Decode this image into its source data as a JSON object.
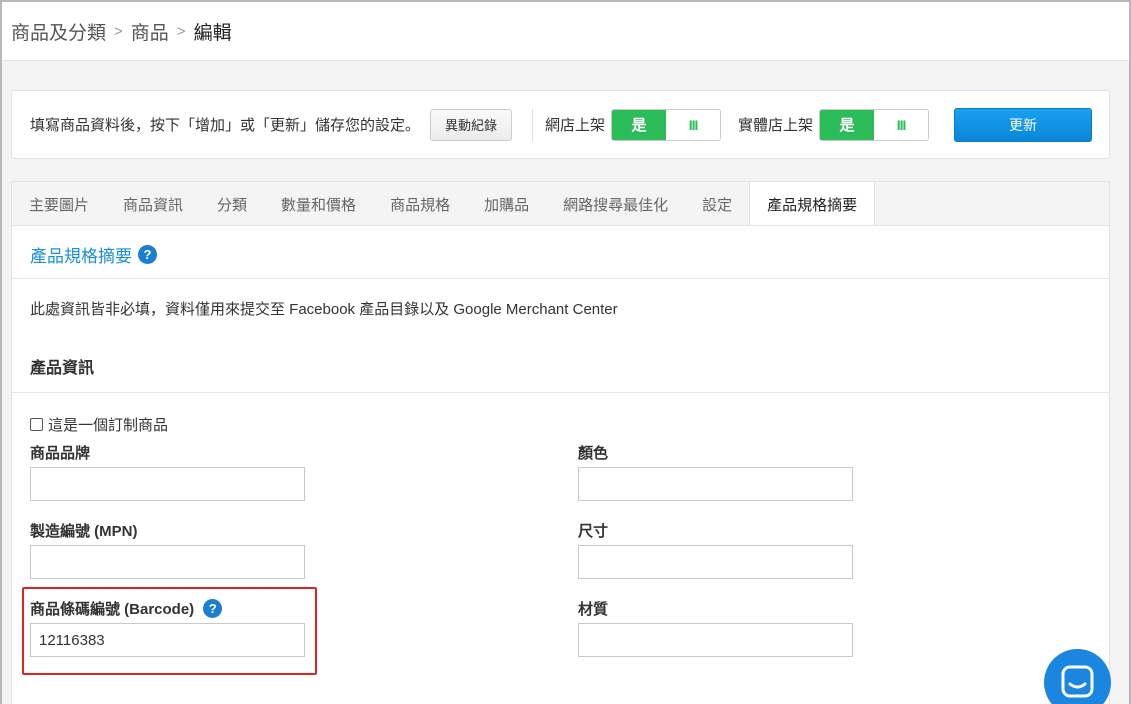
{
  "breadcrumb": {
    "items": [
      "商品及分類",
      "商品",
      "編輯"
    ],
    "separator": ">"
  },
  "toolbar": {
    "hint": "填寫商品資料後，按下「增加」或「更新」儲存您的設定。",
    "log_button": "異動紀錄",
    "online_store_label": "網店上架",
    "physical_store_label": "實體店上架",
    "toggle_on": "是",
    "toggle_off": "III",
    "update_button": "更新"
  },
  "tabs": [
    "主要圖片",
    "商品資訊",
    "分類",
    "數量和價格",
    "商品規格",
    "加購品",
    "網路搜尋最佳化",
    "設定",
    "產品規格摘要"
  ],
  "active_tab_index": 8,
  "panel": {
    "title": "產品規格摘要",
    "description": "此處資訊皆非必填，資料僅用來提交至 Facebook 產品目錄以及 Google Merchant Center",
    "sub_title": "產品資訊",
    "custom_checkbox_label": "這是一個訂制商品",
    "custom_checkbox_checked": false,
    "fields": {
      "brand": {
        "label": "商品品牌",
        "value": ""
      },
      "mpn": {
        "label": "製造編號 (MPN)",
        "value": ""
      },
      "barcode": {
        "label": "商品條碼編號 (Barcode)",
        "value": "12116383"
      },
      "color": {
        "label": "顏色",
        "value": ""
      },
      "size": {
        "label": "尺寸",
        "value": ""
      },
      "material": {
        "label": "材質",
        "value": ""
      }
    }
  },
  "icons": {
    "help": "?",
    "chat": "chat-icon"
  },
  "colors": {
    "accent": "#1a8fd6",
    "toggle_green": "#2dbc5a",
    "update_blue": "#0a86d8",
    "highlight_red": "#e02424"
  }
}
